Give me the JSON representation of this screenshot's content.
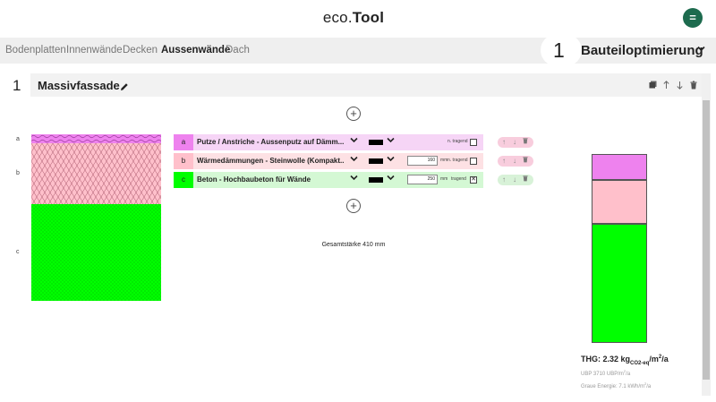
{
  "app": {
    "brand_part1": "eco.",
    "brand_part2": "Tool",
    "menu_icon_label": "="
  },
  "nav": {
    "tabs": [
      {
        "label": "Bodenplatten",
        "active": false
      },
      {
        "label": "Innenwände",
        "active": false
      },
      {
        "label": "Decken",
        "active": false
      },
      {
        "label": "Aussenwände",
        "active": true
      },
      {
        "label": "Dach",
        "active": false
      }
    ],
    "optimization_number": "1",
    "optimization_title": "Bauteiloptimierung",
    "optimization_chevron": "⌄"
  },
  "element": {
    "number": "1",
    "title": "Massivfassade",
    "toolbar_icons": [
      "copy-icon",
      "arrow-up-icon",
      "arrow-down-icon",
      "trash-icon"
    ]
  },
  "section": {
    "side_letters": [
      "a",
      "b",
      "c"
    ],
    "total_thickness": "Gesamtstärke 410 mm"
  },
  "layers": [
    {
      "tag": "a",
      "name": "Putze / Anstriche - Aussenputz auf Dämm...",
      "thickness": "",
      "unit": "",
      "tragend_label": "n. tragend",
      "tragend_checked": false,
      "tag_color": "#ee82ee",
      "row_color": "#f6d5f6",
      "pill_color": "#f8cddd"
    },
    {
      "tag": "b",
      "name": "Wärmedämmungen - Steinwolle (Kompakt...",
      "thickness": "160",
      "unit": "mm",
      "tragend_label": "n. tragend",
      "tragend_checked": false,
      "tag_color": "#ffc0cb",
      "row_color": "#fde1e4",
      "pill_color": "#f8cddd"
    },
    {
      "tag": "c",
      "name": "Beton - Hochbaubeton für Wände",
      "thickness": "250",
      "unit": "mm",
      "tragend_label": "tragend",
      "tragend_checked": true,
      "tag_color": "#00ff00",
      "row_color": "#d4f8d4",
      "pill_color": "#d8f2d8"
    }
  ],
  "results": {
    "thg_label": "THG: 2.32 kg",
    "thg_sub": "CO2-eq",
    "thg_unit_slash": "/m",
    "thg_unit_sup": "2",
    "thg_unit_tail": "/a",
    "ubp_text": "UBP 3710 UBP/m",
    "ubp_sup": "2",
    "ubp_tail": "/a",
    "energy_text": "Graue Energie: 7.1 kWh/m",
    "energy_sup": "2",
    "energy_tail": "/a"
  },
  "colors": {
    "brand_green": "#1d6b4e",
    "layer_a": "#ee82ee",
    "layer_b": "#ffc0cb",
    "layer_c": "#00ff00"
  }
}
